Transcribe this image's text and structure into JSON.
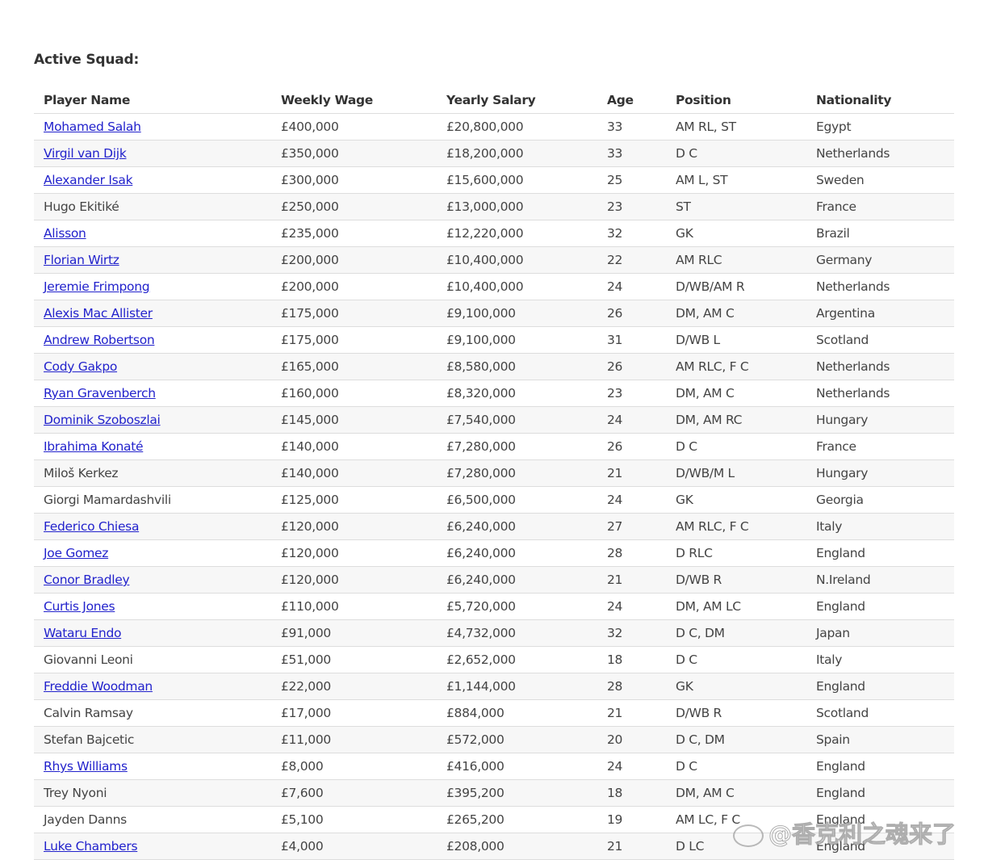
{
  "section_title": "Active Squad:",
  "columns": [
    "Player Name",
    "Weekly Wage",
    "Yearly Salary",
    "Age",
    "Position",
    "Nationality"
  ],
  "rows": [
    {
      "name": "Mohamed Salah",
      "link": true,
      "wage": "£400,000",
      "salary": "£20,800,000",
      "age": "33",
      "position": "AM RL, ST",
      "nationality": "Egypt"
    },
    {
      "name": "Virgil van Dijk",
      "link": true,
      "wage": "£350,000",
      "salary": "£18,200,000",
      "age": "33",
      "position": "D C",
      "nationality": "Netherlands"
    },
    {
      "name": "Alexander Isak",
      "link": true,
      "wage": "£300,000",
      "salary": "£15,600,000",
      "age": "25",
      "position": "AM L, ST",
      "nationality": "Sweden"
    },
    {
      "name": "Hugo Ekitiké",
      "link": false,
      "wage": "£250,000",
      "salary": "£13,000,000",
      "age": "23",
      "position": "ST",
      "nationality": "France"
    },
    {
      "name": "Alisson",
      "link": true,
      "wage": "£235,000",
      "salary": "£12,220,000",
      "age": "32",
      "position": "GK",
      "nationality": "Brazil"
    },
    {
      "name": "Florian Wirtz",
      "link": true,
      "wage": "£200,000",
      "salary": "£10,400,000",
      "age": "22",
      "position": "AM RLC",
      "nationality": "Germany"
    },
    {
      "name": "Jeremie Frimpong",
      "link": true,
      "wage": "£200,000",
      "salary": "£10,400,000",
      "age": "24",
      "position": "D/WB/AM R",
      "nationality": "Netherlands"
    },
    {
      "name": "Alexis Mac Allister",
      "link": true,
      "wage": "£175,000",
      "salary": "£9,100,000",
      "age": "26",
      "position": "DM, AM C",
      "nationality": "Argentina"
    },
    {
      "name": "Andrew Robertson",
      "link": true,
      "wage": "£175,000",
      "salary": "£9,100,000",
      "age": "31",
      "position": "D/WB L",
      "nationality": "Scotland"
    },
    {
      "name": "Cody Gakpo",
      "link": true,
      "wage": "£165,000",
      "salary": "£8,580,000",
      "age": "26",
      "position": "AM RLC, F C",
      "nationality": "Netherlands"
    },
    {
      "name": "Ryan Gravenberch",
      "link": true,
      "wage": "£160,000",
      "salary": "£8,320,000",
      "age": "23",
      "position": "DM, AM C",
      "nationality": "Netherlands"
    },
    {
      "name": "Dominik Szoboszlai",
      "link": true,
      "wage": "£145,000",
      "salary": "£7,540,000",
      "age": "24",
      "position": "DM, AM RC",
      "nationality": "Hungary"
    },
    {
      "name": "Ibrahima Konaté",
      "link": true,
      "wage": "£140,000",
      "salary": "£7,280,000",
      "age": "26",
      "position": "D C",
      "nationality": "France"
    },
    {
      "name": "Miloš Kerkez",
      "link": false,
      "wage": "£140,000",
      "salary": "£7,280,000",
      "age": "21",
      "position": "D/WB/M L",
      "nationality": "Hungary"
    },
    {
      "name": "Giorgi Mamardashvili",
      "link": false,
      "wage": "£125,000",
      "salary": "£6,500,000",
      "age": "24",
      "position": "GK",
      "nationality": "Georgia"
    },
    {
      "name": "Federico Chiesa",
      "link": true,
      "wage": "£120,000",
      "salary": "£6,240,000",
      "age": "27",
      "position": "AM RLC, F C",
      "nationality": "Italy"
    },
    {
      "name": "Joe Gomez",
      "link": true,
      "wage": "£120,000",
      "salary": "£6,240,000",
      "age": "28",
      "position": "D RLC",
      "nationality": "England"
    },
    {
      "name": "Conor Bradley",
      "link": true,
      "wage": "£120,000",
      "salary": "£6,240,000",
      "age": "21",
      "position": "D/WB R",
      "nationality": "N.Ireland"
    },
    {
      "name": "Curtis Jones",
      "link": true,
      "wage": "£110,000",
      "salary": "£5,720,000",
      "age": "24",
      "position": "DM, AM LC",
      "nationality": "England"
    },
    {
      "name": "Wataru Endo",
      "link": true,
      "wage": "£91,000",
      "salary": "£4,732,000",
      "age": "32",
      "position": "D C, DM",
      "nationality": "Japan"
    },
    {
      "name": "Giovanni Leoni",
      "link": false,
      "wage": "£51,000",
      "salary": "£2,652,000",
      "age": "18",
      "position": "D C",
      "nationality": "Italy"
    },
    {
      "name": "Freddie Woodman",
      "link": true,
      "wage": "£22,000",
      "salary": "£1,144,000",
      "age": "28",
      "position": "GK",
      "nationality": "England"
    },
    {
      "name": "Calvin Ramsay",
      "link": false,
      "wage": "£17,000",
      "salary": "£884,000",
      "age": "21",
      "position": "D/WB R",
      "nationality": "Scotland"
    },
    {
      "name": "Stefan Bajcetic",
      "link": false,
      "wage": "£11,000",
      "salary": "£572,000",
      "age": "20",
      "position": "D C, DM",
      "nationality": "Spain"
    },
    {
      "name": "Rhys Williams",
      "link": true,
      "wage": "£8,000",
      "salary": "£416,000",
      "age": "24",
      "position": "D C",
      "nationality": "England"
    },
    {
      "name": "Trey Nyoni",
      "link": false,
      "wage": "£7,600",
      "salary": "£395,200",
      "age": "18",
      "position": "DM, AM C",
      "nationality": "England"
    },
    {
      "name": "Jayden Danns",
      "link": false,
      "wage": "£5,100",
      "salary": "£265,200",
      "age": "19",
      "position": "AM LC, F C",
      "nationality": "England"
    },
    {
      "name": "Luke Chambers",
      "link": true,
      "wage": "£4,000",
      "salary": "£208,000",
      "age": "21",
      "position": "D LC",
      "nationality": "England"
    }
  ],
  "colors": {
    "link": "#2222cc",
    "stripe": "#f7f7f7",
    "border": "#dddddd"
  },
  "watermark": "@香克利之魂来了"
}
